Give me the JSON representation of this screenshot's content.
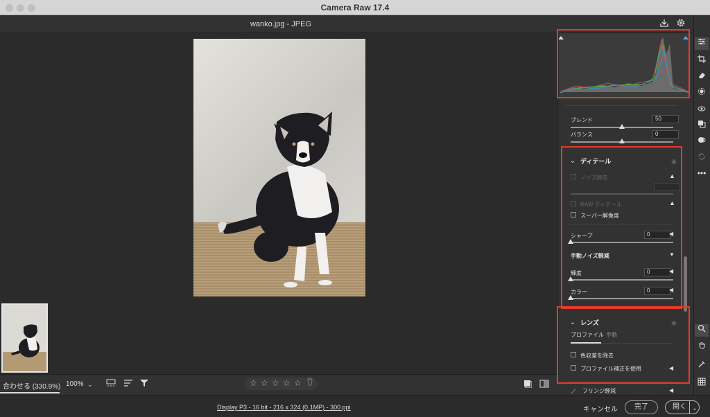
{
  "window": {
    "title": "Camera Raw 17.4"
  },
  "topbar": {
    "filename": "wanko.jpg  -  JPEG"
  },
  "bottombar": {
    "zoom_fit": "合わせる (330.9%)",
    "zoom_pct": "100%"
  },
  "rating": {
    "stars": [
      "☆",
      "☆",
      "☆",
      "☆",
      "☆"
    ]
  },
  "status": {
    "display_info": "Display P3 - 16 bit - 216 x 324 (0.1MP) - 300 ppi"
  },
  "actions": {
    "cancel": "キャンセル",
    "done": "完了",
    "open": "開く"
  },
  "panel": {
    "blend": {
      "label": "ブレンド",
      "value": "50",
      "fraction": 0.5
    },
    "balance": {
      "label": "バランス",
      "value": "0",
      "fraction": 0.5
    },
    "detail": {
      "title": "ディテール",
      "noise_reduction": "ノイズ除去",
      "raw_detail": "RAW ディテール",
      "super_resolution": "スーパー解像度",
      "sharpen": {
        "label": "シャープ",
        "value": "0",
        "fraction": 0
      },
      "manual_noise": "手動ノイズ軽減",
      "luminance": {
        "label": "輝度",
        "value": "0",
        "fraction": 0
      },
      "color": {
        "label": "カラー",
        "value": "0",
        "fraction": 0
      }
    },
    "lens": {
      "title": "レンズ",
      "tab_profile": "プロファイル",
      "tab_manual": "手動",
      "remove_ca": "色収差を除去",
      "use_profile": "プロファイル補正を使用"
    },
    "fringe": {
      "title": "フリンジ軽減"
    }
  },
  "colors": {
    "highlight": "#e53a2c",
    "panel_bg": "#323232"
  },
  "icons": [
    "save-icon",
    "gear-icon",
    "expand-icon",
    "edit-sliders-icon",
    "crop-icon",
    "eraser-icon",
    "mask-icon",
    "redeye-icon",
    "presets-icon",
    "snapshots-icon",
    "sync-icon",
    "more-icon",
    "zoom-icon",
    "hand-icon",
    "color-sampler-icon",
    "grid-icon"
  ]
}
